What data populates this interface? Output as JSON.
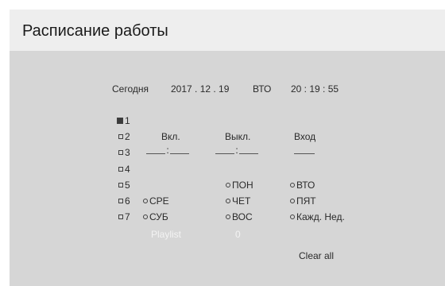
{
  "window": {
    "title": "Расписание работы"
  },
  "status": {
    "today_label": "Сегодня",
    "date": "2017 . 12 . 19",
    "weekday": "ВТО",
    "time": "20 : 19 : 55"
  },
  "slots": [
    {
      "label": "1",
      "selected": true
    },
    {
      "label": "2",
      "selected": false
    },
    {
      "label": "3",
      "selected": false
    },
    {
      "label": "4",
      "selected": false
    },
    {
      "label": "5",
      "selected": false
    },
    {
      "label": "6",
      "selected": false
    },
    {
      "label": "7",
      "selected": false
    }
  ],
  "columns": {
    "on": "Вкл.",
    "off": "Выкл.",
    "input": "Вход"
  },
  "time_fields": {
    "on_sep": ":",
    "off_sep": ":"
  },
  "days": {
    "mon": "ПОН",
    "tue": "ВТО",
    "wed": "СРЕ",
    "thu": "ЧЕТ",
    "fri": "ПЯТ",
    "sat": "СУБ",
    "sun": "ВОС",
    "every_week": "Кажд. Нед."
  },
  "playlist": {
    "label": "Playlist",
    "value": "0"
  },
  "actions": {
    "clear_all": "Clear all"
  }
}
